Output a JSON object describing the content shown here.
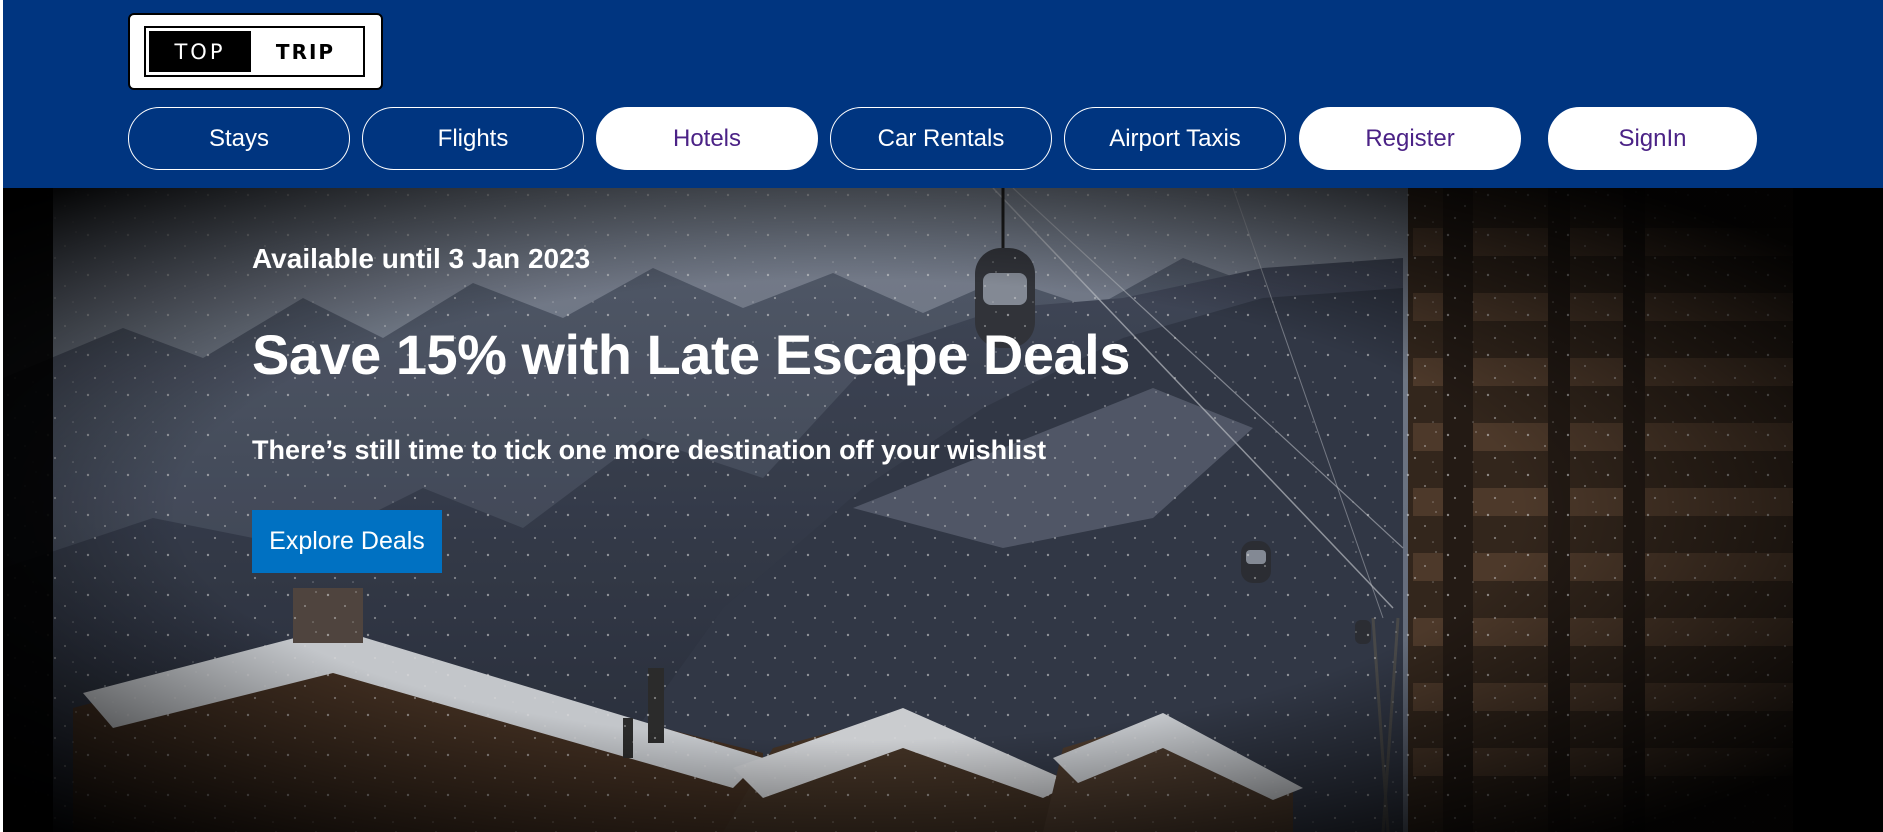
{
  "logo": {
    "top": "TOP",
    "trip": "TRIP"
  },
  "nav": {
    "stays": "Stays",
    "flights": "Flights",
    "hotels": "Hotels",
    "car_rentals": "Car Rentals",
    "airport_taxis": "Airport Taxis",
    "register": "Register",
    "signin": "SignIn"
  },
  "hero": {
    "availability": "Available until 3 Jan 2023",
    "headline": "Save 15% with Late Escape Deals",
    "subline": "There’s still time to tick one more destination off your wishlist",
    "cta": "Explore Deals"
  },
  "colors": {
    "header_bg": "#003580",
    "nav_text_filled": "#4b2286",
    "cta_bg": "#0071c2"
  }
}
